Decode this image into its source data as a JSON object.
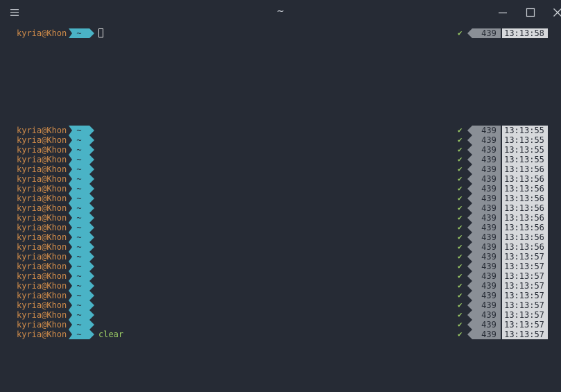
{
  "window": {
    "title": "~",
    "menu_icon": "hamburger-menu-icon",
    "minimize_icon": "minimize-icon",
    "maximize_icon": "maximize-icon",
    "close_icon": "close-icon"
  },
  "colors": {
    "background": "#262b35",
    "user": "#d08c4a",
    "dir_segment": "#4ab3c6",
    "history_segment": "#8a8f96",
    "time_segment": "#d7d9dc",
    "command": "#9ccc65",
    "check": "#9ccc65"
  },
  "prompt": {
    "user": "kyria@Khon",
    "dir": "~",
    "check": "✔",
    "history": "439"
  },
  "current_line": {
    "time": "13:13:58",
    "command": ""
  },
  "history_lines": [
    {
      "time": "13:13:55",
      "command": ""
    },
    {
      "time": "13:13:55",
      "command": ""
    },
    {
      "time": "13:13:55",
      "command": ""
    },
    {
      "time": "13:13:55",
      "command": ""
    },
    {
      "time": "13:13:56",
      "command": ""
    },
    {
      "time": "13:13:56",
      "command": ""
    },
    {
      "time": "13:13:56",
      "command": ""
    },
    {
      "time": "13:13:56",
      "command": ""
    },
    {
      "time": "13:13:56",
      "command": ""
    },
    {
      "time": "13:13:56",
      "command": ""
    },
    {
      "time": "13:13:56",
      "command": ""
    },
    {
      "time": "13:13:56",
      "command": ""
    },
    {
      "time": "13:13:56",
      "command": ""
    },
    {
      "time": "13:13:57",
      "command": ""
    },
    {
      "time": "13:13:57",
      "command": ""
    },
    {
      "time": "13:13:57",
      "command": ""
    },
    {
      "time": "13:13:57",
      "command": ""
    },
    {
      "time": "13:13:57",
      "command": ""
    },
    {
      "time": "13:13:57",
      "command": ""
    },
    {
      "time": "13:13:57",
      "command": ""
    },
    {
      "time": "13:13:57",
      "command": ""
    },
    {
      "time": "13:13:57",
      "command": "clear"
    }
  ]
}
